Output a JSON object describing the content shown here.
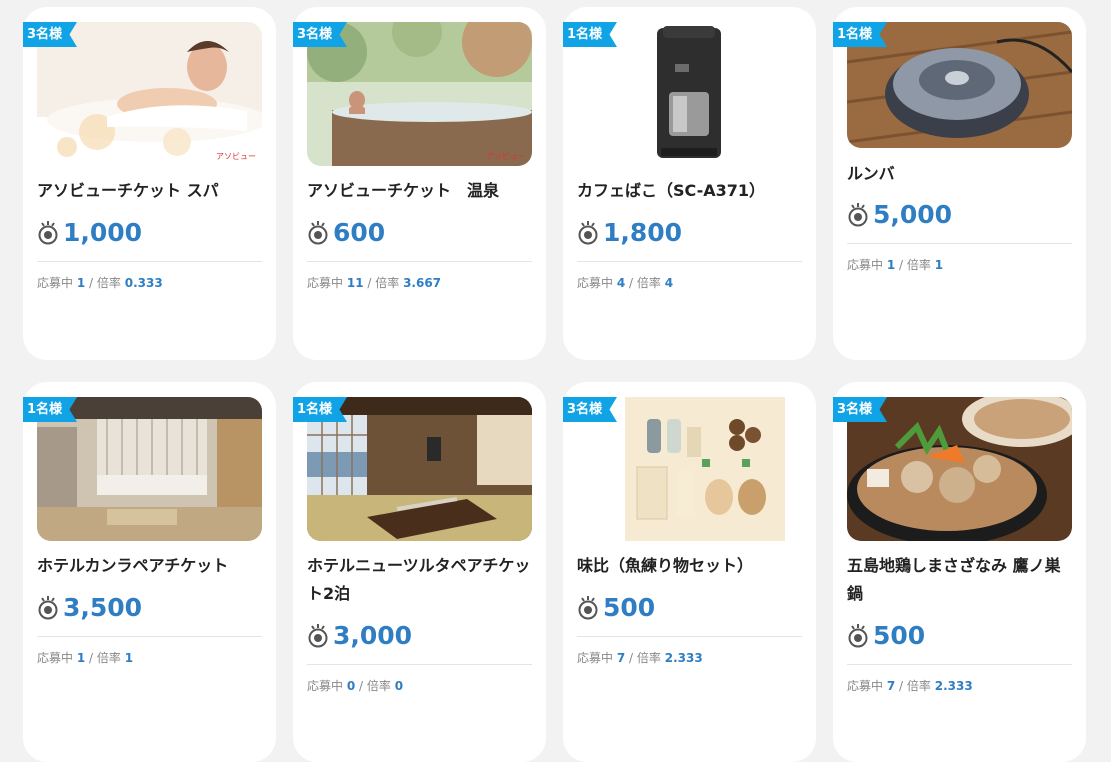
{
  "colors": {
    "accent": "#2f7ec4",
    "badge": "#10a3e6",
    "background": "#f2f2f2"
  },
  "labels": {
    "applicants": "応募中",
    "sep": " / ",
    "ratio": "倍率"
  },
  "items": [
    {
      "badge": "3名様",
      "title": "アソビューチケット スパ",
      "price": "1,000",
      "applicants": "1",
      "ratio": "0.333",
      "photo_mark": "アソビュー"
    },
    {
      "badge": "3名様",
      "title": "アソビューチケット　温泉",
      "price": "600",
      "applicants": "11",
      "ratio": "3.667",
      "photo_mark": "アソビュー"
    },
    {
      "badge": "1名様",
      "title": "カフェばこ（SC-A371）",
      "price": "1,800",
      "applicants": "4",
      "ratio": "4"
    },
    {
      "badge": "1名様",
      "title": "ルンバ",
      "price": "5,000",
      "applicants": "1",
      "ratio": "1"
    },
    {
      "badge": "1名様",
      "title": "ホテルカンラペアチケット",
      "price": "3,500",
      "applicants": "1",
      "ratio": "1"
    },
    {
      "badge": "1名様",
      "title": "ホテルニューツルタペアチケット2泊",
      "price": "3,000",
      "applicants": "0",
      "ratio": "0"
    },
    {
      "badge": "3名様",
      "title": "味比（魚練り物セット）",
      "price": "500",
      "applicants": "7",
      "ratio": "2.333"
    },
    {
      "badge": "3名様",
      "title": "五島地鶏しまさざなみ 鷹ノ巣鍋",
      "price": "500",
      "applicants": "7",
      "ratio": "2.333"
    }
  ]
}
